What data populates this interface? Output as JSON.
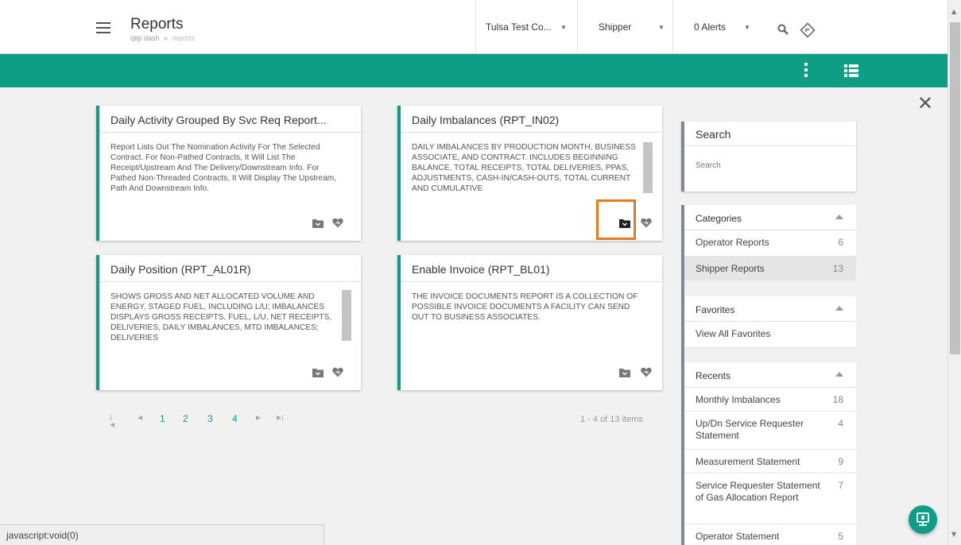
{
  "header": {
    "title": "Reports",
    "breadcrumb": [
      "qtip dash",
      "reports"
    ],
    "breadcrumb_sep": "»",
    "company_select": "Tulsa Test Co...",
    "role_select": "Shipper",
    "alerts_select": "0 Alerts"
  },
  "cards": [
    {
      "title": "Daily Activity Grouped By Svc Req Report...",
      "description": "Report Lists Out The Nomination Activity For The Selected Contract. For Non-Pathed Contracts, It Will List The Receipt/Upstream And The Delivery/Downstream Info. For Pathed Non-Threaded Contracts, It Will Display The Upstream, Path And Downstream Info."
    },
    {
      "title": "Daily Imbalances (RPT_IN02)",
      "description": "DAILY IMBALANCES BY PRODUCTION MONTH, BUSINESS ASSOCIATE, AND CONTRACT. INCLUDES BEGINNING BALANCE, TOTAL RECEIPTS, TOTAL DELIVERIES, PPAS, ADJUSTMENTS, CASH-IN/CASH-OUTS, TOTAL CURRENT AND CUMULATIVE"
    },
    {
      "title": "Daily Position (RPT_AL01R)",
      "description": "SHOWS GROSS AND NET ALLOCATED VOLUME AND ENERGY, STAGED FUEL, INCLUDING L/U; IMBALANCES DISPLAYS GROSS RECEIPTS, FUEL, L/U, NET RECEIPTS, DELIVERIES, DAILY IMBALANCES, MTD IMBALANCES; DELIVERIES"
    },
    {
      "title": "Enable Invoice (RPT_BL01)",
      "description": "THE INVOICE DOCUMENTS REPORT IS A COLLECTION OF POSSIBLE INVOICE DOCUMENTS A FACILITY CAN SEND OUT TO BUSINESS ASSOCIATES."
    }
  ],
  "pager": {
    "pages": [
      "1",
      "2",
      "3",
      "4"
    ],
    "current_page": "1",
    "summary": "1 - 4 of 13 items"
  },
  "search": {
    "title": "Search",
    "placeholder": "Search"
  },
  "categories": {
    "title": "Categories",
    "items": [
      {
        "label": "Operator Reports",
        "count": "6"
      },
      {
        "label": "Shipper Reports",
        "count": "13"
      }
    ]
  },
  "favorites": {
    "title": "Favorites",
    "items": [
      {
        "label": "View All Favorites"
      }
    ]
  },
  "recents": {
    "title": "Recents",
    "items": [
      {
        "label": "Monthly Imbalances",
        "count": "18"
      },
      {
        "label": "Up/Dn Service Requester Statement",
        "count": "4"
      },
      {
        "label": "Measurement Statement",
        "count": "9"
      },
      {
        "label": "Service Requester Statement of Gas Allocation Report",
        "count": "7"
      },
      {
        "label": "Operator Statement",
        "count": "5"
      }
    ]
  },
  "status_bar": "javascript:void(0)",
  "colors": {
    "accent": "#0e9e86",
    "highlight": "#e87722",
    "panel_border": "#7b8a9a"
  }
}
